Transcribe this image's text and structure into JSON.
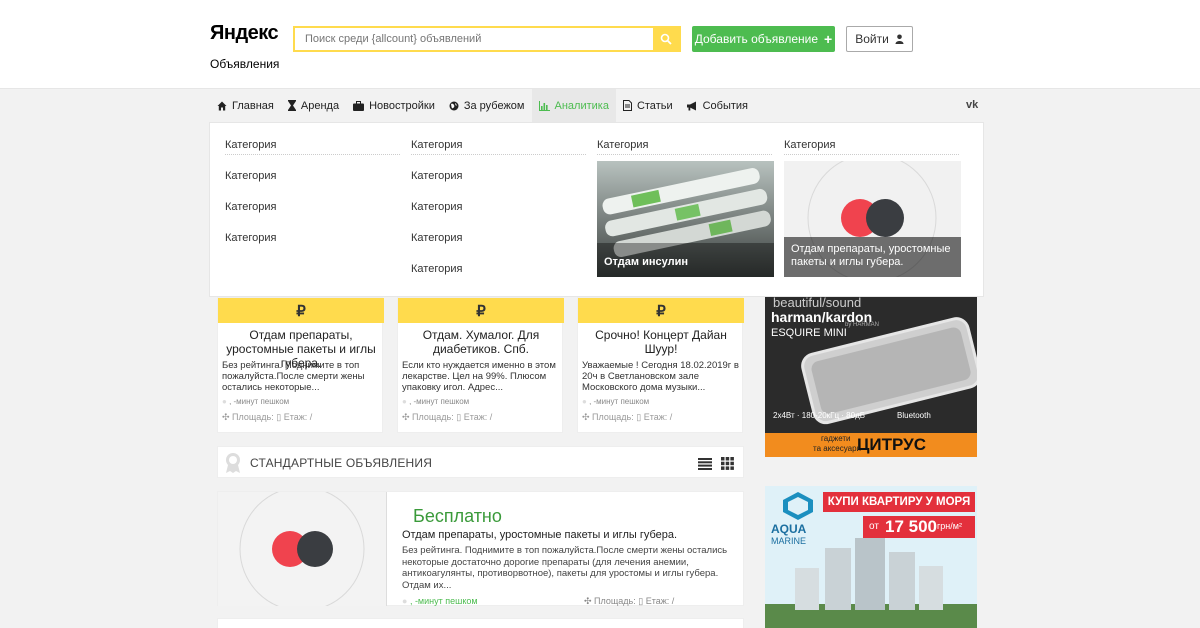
{
  "header": {
    "logo": "Яндекс",
    "logo_sub": "Объявления",
    "search_placeholder": "Поиск среди {allcount} объявлений",
    "add_button": "Добавить объявление",
    "login_button": "Войти"
  },
  "nav": {
    "items": [
      {
        "label": "Главная",
        "icon": "home-icon"
      },
      {
        "label": "Аренда",
        "icon": "hourglass-icon"
      },
      {
        "label": "Новостройки",
        "icon": "briefcase-icon"
      },
      {
        "label": "За рубежом",
        "icon": "globe-icon"
      },
      {
        "label": "Аналитика",
        "icon": "bar-chart-icon"
      },
      {
        "label": "Статьи",
        "icon": "document-icon"
      },
      {
        "label": "События",
        "icon": "megaphone-icon"
      }
    ],
    "social": "vk"
  },
  "dropdown": {
    "col1_head": "Категория",
    "col1": [
      "Категория",
      "Категория",
      "Категория"
    ],
    "col2_head": "Категория",
    "col2": [
      "Категория",
      "Категория",
      "Категория",
      "Категория"
    ],
    "col3_head": "Категория",
    "col3_caption": "Отдам инсулин",
    "col4_head": "Категория",
    "col4_caption": "Отдам препараты, уростомные пакеты и иглы губера."
  },
  "cards": [
    {
      "currency": "₽",
      "title": "Отдам препараты, уростомные пакеты и иглы губера.",
      "desc": "Без рейтинга. Поднимите в топ пожалуйста.После смерти жены остались некоторые...",
      "meta1": ", -минут пешком",
      "meta2_area": "Площадь:",
      "meta2_floor": "Етаж: /"
    },
    {
      "currency": "₽",
      "title": "Отдам. Хумалог. Для диабетиков. Спб.",
      "desc": "Если кто нуждается именно в этом лекарстве. Цел на 99%. Плюсом упаковку игол. Адрес...",
      "meta1": ", -минут пешком",
      "meta2_area": "Площадь:",
      "meta2_floor": "Етаж: /"
    },
    {
      "currency": "₽",
      "title": "Срочно! Концерт Дайан Шуур!",
      "desc": "Уважаемые ! Сегодня 18.02.2019г в 20ч в Светлановском зале Московского дома музыки...",
      "meta1": ", -минут пешком",
      "meta2_area": "Площадь:",
      "meta2_floor": "Етаж: /"
    }
  ],
  "ads": {
    "ad1_top": "beautiful/sound",
    "ad1_brand": "harman/kardon",
    "ad1_sub": "by HARMAN",
    "ad1_model": "ESQUIRE MINI",
    "ad1_specs": "2x4Вт · 180-20кГц · 80дБ",
    "ad1_bt": "Bluetooth",
    "ad1_tag1": "гаджети",
    "ad1_tag2": "та аксесуари",
    "ad1_shop": "ЦИТРУС",
    "ad2_title": "КУПИ КВАРТИРУ У МОРЯ",
    "ad2_from": "от",
    "ad2_price": "17 500",
    "ad2_unit": "грн/м²",
    "ad2_brand": "AQUA",
    "ad2_brand2": "MARINE"
  },
  "standard": {
    "label": "СТАНДАРТНЫЕ ОБЪЯВЛЕНИЯ"
  },
  "listing": {
    "price": "Бесплатно",
    "title": "Отдам препараты, уростомные пакеты и иглы губера.",
    "desc": "Без рейтинга. Поднимите в топ пожалуйста.После смерти жены остались некоторые достаточно дорогие препараты (для лечения анемии, антикоагулянты, противорвотное), пакеты для уростомы и иглы губера. Отдам их...",
    "walk": ", -минут пешком",
    "area": "Площадь:",
    "floor": "Етаж: /"
  },
  "colors": {
    "accent_yellow": "#ffdb4d",
    "accent_green": "#4dbc50",
    "brand_red": "#ff0000"
  }
}
